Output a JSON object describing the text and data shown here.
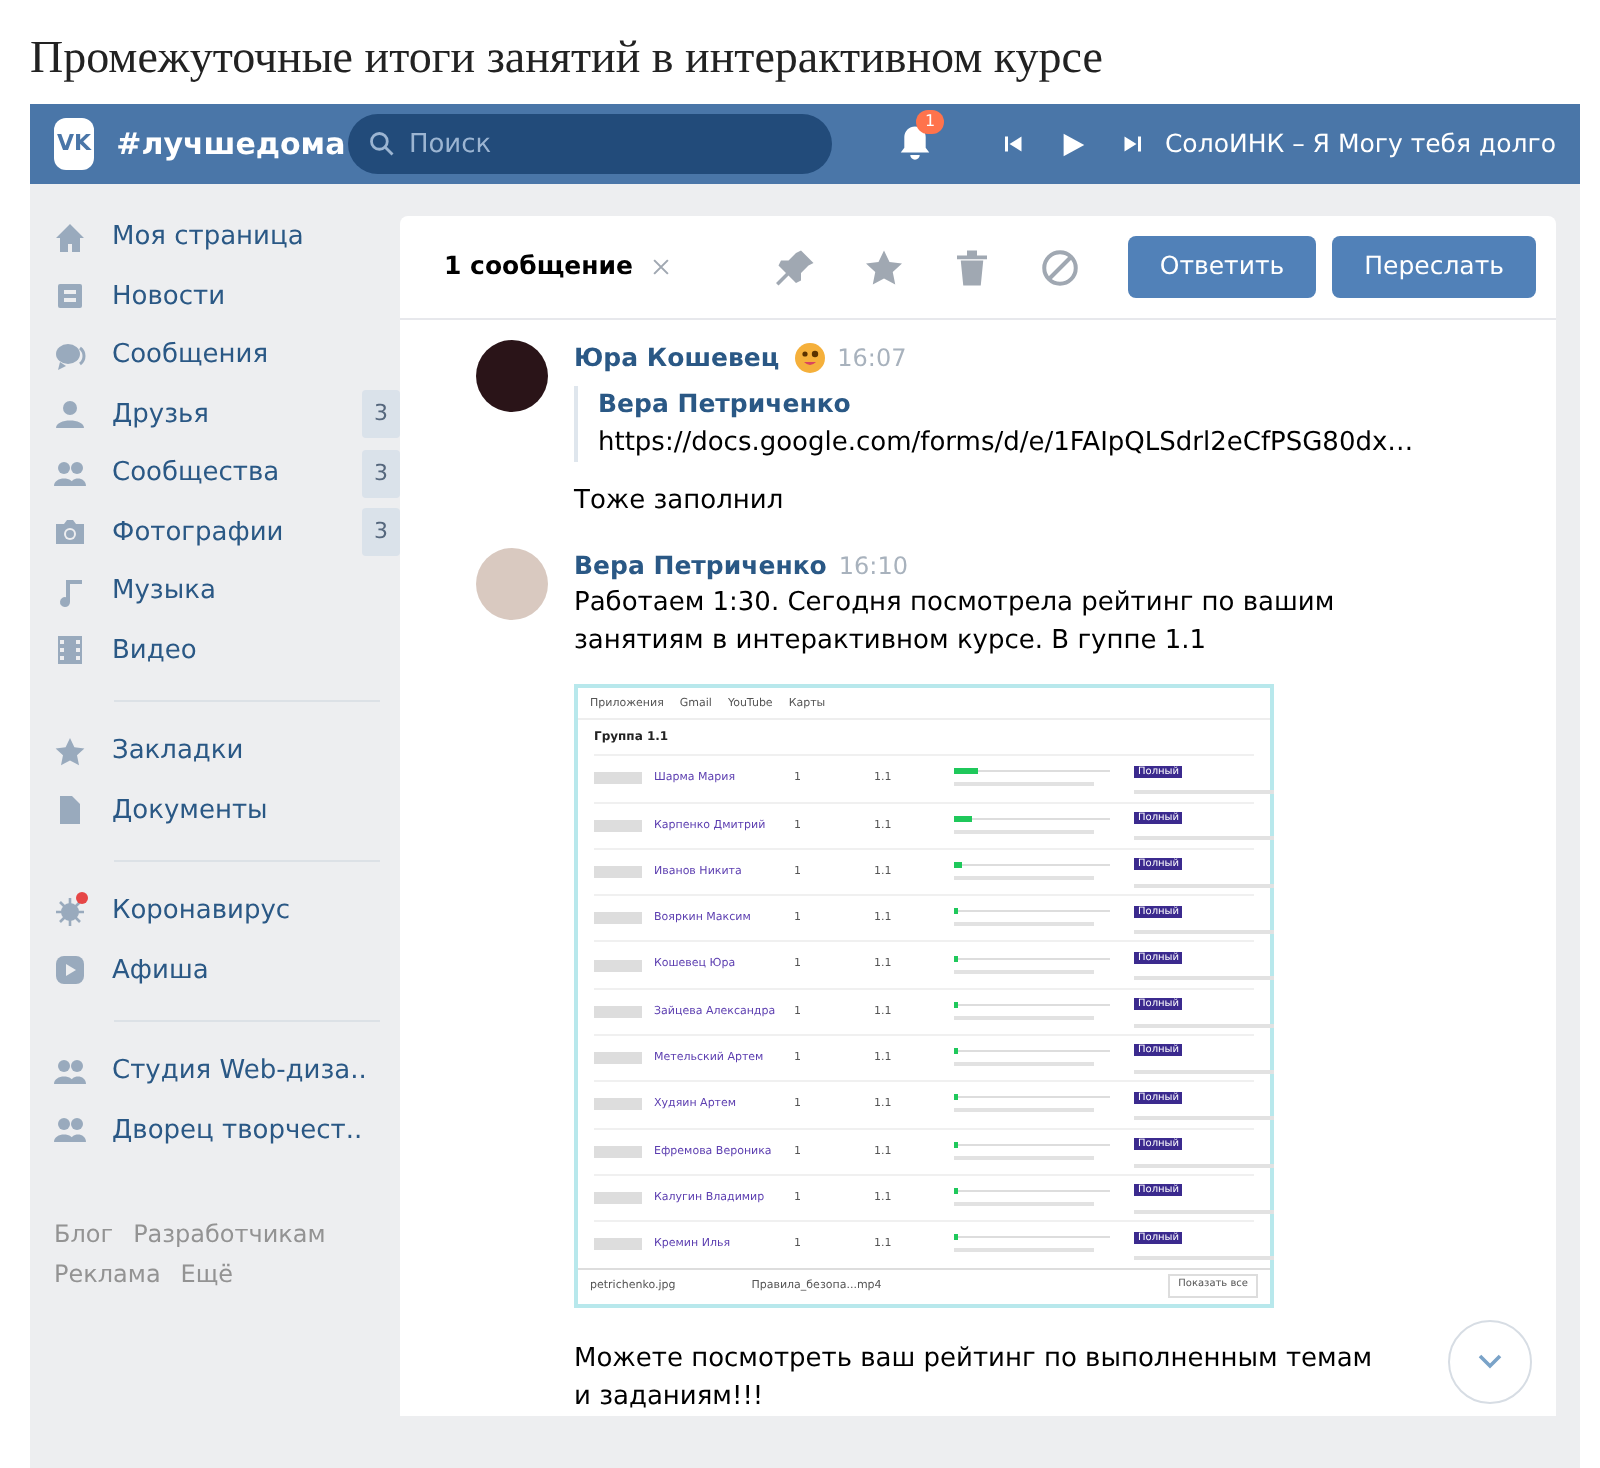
{
  "page_title": "Промежуточные итоги занятий в интерактивном курсе",
  "header": {
    "logo_mark": "VK",
    "logo": "#лучшедома",
    "search": {
      "placeholder": "Поиск"
    },
    "notifications": "1",
    "player": {
      "track": "СолоИНК – Я Могу тебя долго"
    }
  },
  "sidebar": {
    "groups": [
      [
        {
          "kind": "home",
          "label": "Моя страница"
        },
        {
          "kind": "news",
          "label": "Новости"
        },
        {
          "kind": "chat",
          "label": "Сообщения"
        },
        {
          "kind": "person",
          "label": "Друзья",
          "count": "3"
        },
        {
          "kind": "people",
          "label": "Сообщества",
          "count": "3"
        },
        {
          "kind": "camera",
          "label": "Фотографии",
          "count": "3"
        },
        {
          "kind": "music",
          "label": "Музыка"
        },
        {
          "kind": "film",
          "label": "Видео"
        }
      ],
      [
        {
          "kind": "star",
          "label": "Закладки"
        },
        {
          "kind": "doc",
          "label": "Документы"
        }
      ],
      [
        {
          "kind": "virus",
          "label": "Коронавирус",
          "alert": true
        },
        {
          "kind": "play",
          "label": "Афиша"
        }
      ],
      [
        {
          "kind": "people",
          "label": "Студия Web-диза.."
        },
        {
          "kind": "people",
          "label": "Дворец творчест.."
        }
      ]
    ],
    "footer": [
      "Блог",
      "Разработчикам",
      "Реклама",
      "Ещё"
    ]
  },
  "toolbar": {
    "count": "1 сообщение",
    "buttons": [
      "Ответить",
      "Переслать"
    ]
  },
  "messages": [
    {
      "author": "Юра Кошевец",
      "time": "16:07",
      "quote": {
        "author": "Вера Петриченко",
        "text": "https://docs.google.com/forms/d/e/1FAIpQLSdrl2eCfPSG80dx…"
      },
      "text": "Тоже заполнил"
    },
    {
      "author": "Вера Петриченко",
      "time": "16:10",
      "text": "Работаем 1:30. Сегодня посмотрела рейтинг по вашим занятиям в интерактивном курсе. В гуппе 1.1",
      "attachment": {
        "bookmarks": [
          "Приложения",
          "Gmail",
          "YouTube",
          "Карты"
        ],
        "group": "Группа 1.1",
        "rows": [
          {
            "name": "Шарма Мария",
            "col_3": "1",
            "col_4": "1.1",
            "level": 0.15,
            "tag": "Полный"
          },
          {
            "name": "Карпенко Дмитрий",
            "col_3": "1",
            "col_4": "1.1",
            "level": 0.12,
            "tag": "Полный"
          },
          {
            "name": "Иванов Никита",
            "col_3": "1",
            "col_4": "1.1",
            "level": 0.05,
            "tag": "Полный"
          },
          {
            "name": "Вояркин Максим",
            "col_3": "1",
            "col_4": "1.1",
            "level": 0.03,
            "tag": "Полный"
          },
          {
            "name": "Кошевец Юра",
            "col_3": "1",
            "col_4": "1.1",
            "level": 0.03,
            "tag": "Полный"
          },
          {
            "name": "Зайцева Александра",
            "col_3": "1",
            "col_4": "1.1",
            "level": 0.02,
            "tag": "Полный"
          },
          {
            "name": "Метельский Артем",
            "col_3": "1",
            "col_4": "1.1",
            "level": 0.02,
            "tag": "Полный"
          },
          {
            "name": "Худяин Артем",
            "col_3": "1",
            "col_4": "1.1",
            "level": 0.02,
            "tag": "Полный"
          },
          {
            "name": "Ефремова Вероника",
            "col_3": "1",
            "col_4": "1.1",
            "level": 0.02,
            "tag": "Полный"
          },
          {
            "name": "Калугин Владимир",
            "col_3": "1",
            "col_4": "1.1",
            "level": 0.02,
            "tag": "Полный"
          },
          {
            "name": "Кремин Илья",
            "col_3": "1",
            "col_4": "1.1",
            "level": 0.02,
            "tag": "Полный"
          }
        ],
        "downloads": [
          "petrichenko.jpg",
          "Правила_безопа...mp4"
        ],
        "show_all": "Показать все"
      },
      "text_after": "Можете посмотреть ваш рейтинг по выполненным темам и заданиям!!!"
    }
  ]
}
